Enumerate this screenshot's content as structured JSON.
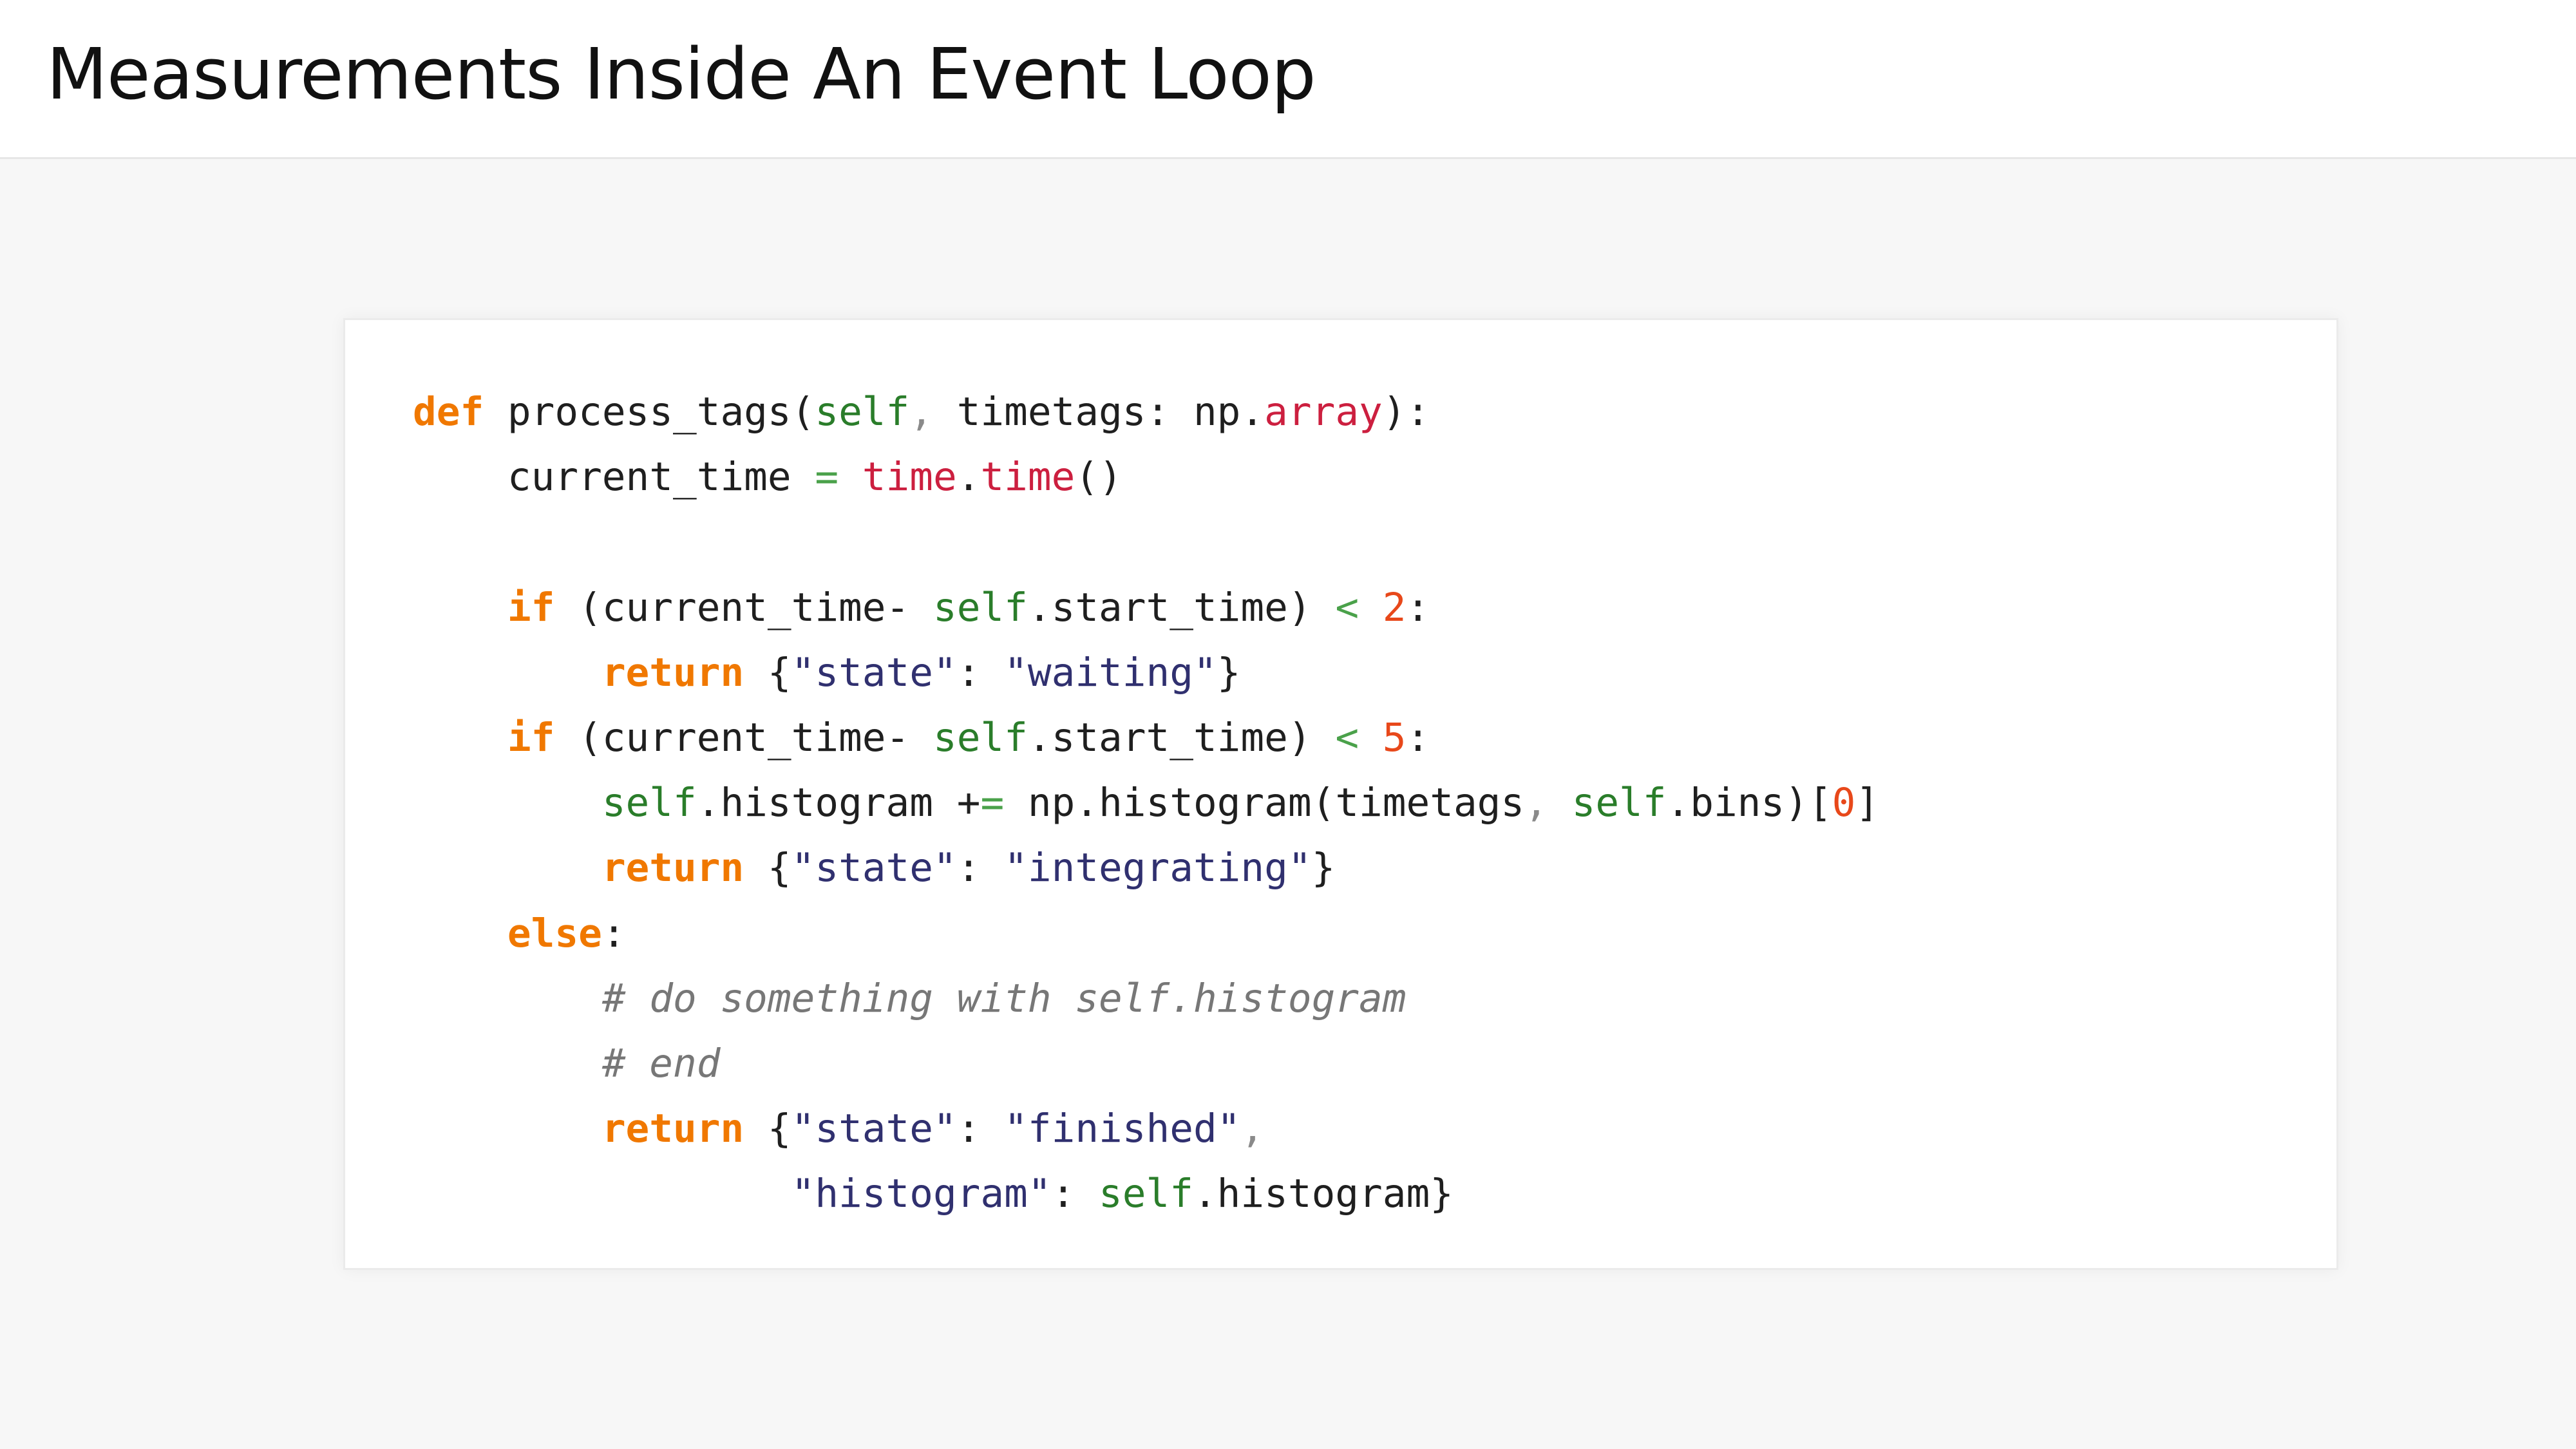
{
  "slide": {
    "title": "Measurements Inside An Event Loop"
  },
  "colors": {
    "keyword": "#f07800",
    "self": "#2a7d2a",
    "builtin": "#cc1f3f",
    "operator": "#4aa14a",
    "number": "#e8481a",
    "string": "#30306f",
    "comment": "#777777",
    "text": "#1f1f1f",
    "background": "#f7f7f7",
    "card": "#ffffff"
  },
  "code": {
    "language": "python",
    "lines": [
      [
        {
          "t": "def",
          "k": "kw"
        },
        {
          "t": " process_tags(",
          "k": "plain"
        },
        {
          "t": "self",
          "k": "slf"
        },
        {
          "t": ",",
          "k": "pun"
        },
        {
          "t": " timetags: np.",
          "k": "plain"
        },
        {
          "t": "array",
          "k": "blt"
        },
        {
          "t": "):",
          "k": "plain"
        }
      ],
      [
        {
          "t": "    current_time ",
          "k": "plain"
        },
        {
          "t": "=",
          "k": "opg"
        },
        {
          "t": " ",
          "k": "plain"
        },
        {
          "t": "time",
          "k": "blt"
        },
        {
          "t": ".",
          "k": "plain"
        },
        {
          "t": "time",
          "k": "blt"
        },
        {
          "t": "()",
          "k": "plain"
        }
      ],
      [],
      [
        {
          "t": "    ",
          "k": "plain"
        },
        {
          "t": "if",
          "k": "kw"
        },
        {
          "t": " (current_time- ",
          "k": "plain"
        },
        {
          "t": "self",
          "k": "slf"
        },
        {
          "t": ".start_time) ",
          "k": "plain"
        },
        {
          "t": "<",
          "k": "opg"
        },
        {
          "t": " ",
          "k": "plain"
        },
        {
          "t": "2",
          "k": "num"
        },
        {
          "t": ":",
          "k": "plain"
        }
      ],
      [
        {
          "t": "        ",
          "k": "plain"
        },
        {
          "t": "return",
          "k": "kw"
        },
        {
          "t": " {",
          "k": "plain"
        },
        {
          "t": "\"state\"",
          "k": "str"
        },
        {
          "t": ": ",
          "k": "plain"
        },
        {
          "t": "\"waiting\"",
          "k": "str"
        },
        {
          "t": "}",
          "k": "plain"
        }
      ],
      [
        {
          "t": "    ",
          "k": "plain"
        },
        {
          "t": "if",
          "k": "kw"
        },
        {
          "t": " (current_time- ",
          "k": "plain"
        },
        {
          "t": "self",
          "k": "slf"
        },
        {
          "t": ".start_time) ",
          "k": "plain"
        },
        {
          "t": "<",
          "k": "opg"
        },
        {
          "t": " ",
          "k": "plain"
        },
        {
          "t": "5",
          "k": "num"
        },
        {
          "t": ":",
          "k": "plain"
        }
      ],
      [
        {
          "t": "        ",
          "k": "plain"
        },
        {
          "t": "self",
          "k": "slf"
        },
        {
          "t": ".histogram ",
          "k": "plain"
        },
        {
          "t": "+",
          "k": "plain"
        },
        {
          "t": "=",
          "k": "opg"
        },
        {
          "t": " np.histogram(timetags",
          "k": "plain"
        },
        {
          "t": ",",
          "k": "pun"
        },
        {
          "t": " ",
          "k": "plain"
        },
        {
          "t": "self",
          "k": "slf"
        },
        {
          "t": ".bins)[",
          "k": "plain"
        },
        {
          "t": "0",
          "k": "num"
        },
        {
          "t": "]",
          "k": "plain"
        }
      ],
      [
        {
          "t": "        ",
          "k": "plain"
        },
        {
          "t": "return",
          "k": "kw"
        },
        {
          "t": " {",
          "k": "plain"
        },
        {
          "t": "\"state\"",
          "k": "str"
        },
        {
          "t": ": ",
          "k": "plain"
        },
        {
          "t": "\"integrating\"",
          "k": "str"
        },
        {
          "t": "}",
          "k": "plain"
        }
      ],
      [
        {
          "t": "    ",
          "k": "plain"
        },
        {
          "t": "else",
          "k": "kw"
        },
        {
          "t": ":",
          "k": "plain"
        }
      ],
      [
        {
          "t": "        ",
          "k": "plain"
        },
        {
          "t": "# do something with self.histogram",
          "k": "cmt"
        }
      ],
      [
        {
          "t": "        ",
          "k": "plain"
        },
        {
          "t": "# end",
          "k": "cmt"
        }
      ],
      [
        {
          "t": "        ",
          "k": "plain"
        },
        {
          "t": "return",
          "k": "kw"
        },
        {
          "t": " {",
          "k": "plain"
        },
        {
          "t": "\"state\"",
          "k": "str"
        },
        {
          "t": ": ",
          "k": "plain"
        },
        {
          "t": "\"finished\"",
          "k": "str"
        },
        {
          "t": ",",
          "k": "pun"
        }
      ],
      [
        {
          "t": "                ",
          "k": "plain"
        },
        {
          "t": "\"histogram\"",
          "k": "str"
        },
        {
          "t": ": ",
          "k": "plain"
        },
        {
          "t": "self",
          "k": "slf"
        },
        {
          "t": ".histogram}",
          "k": "plain"
        }
      ]
    ]
  }
}
